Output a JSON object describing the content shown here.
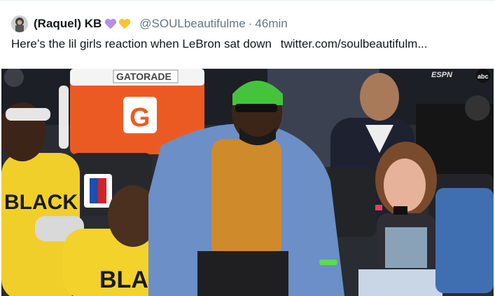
{
  "tweet": {
    "display_name": "(Raquel) KB",
    "handle": "@SOULbeautifulme",
    "separator": "·",
    "time": "46min",
    "text": "Here’s the lil girls reaction when LeBron sat down",
    "link": "twitter.com/soulbeautifulm...",
    "emoji": [
      "purple-heart",
      "yellow-heart"
    ]
  },
  "media": {
    "cooler_brand": "GATORADE",
    "shirt_text_left": "BLACK",
    "shirt_text_right": "BLACK",
    "broadcast_logo": "ESPN",
    "network_logo": "abc"
  },
  "colors": {
    "purple_heart": "#b48ee8",
    "yellow_heart": "#f5c430",
    "handle_gray": "#657786"
  }
}
